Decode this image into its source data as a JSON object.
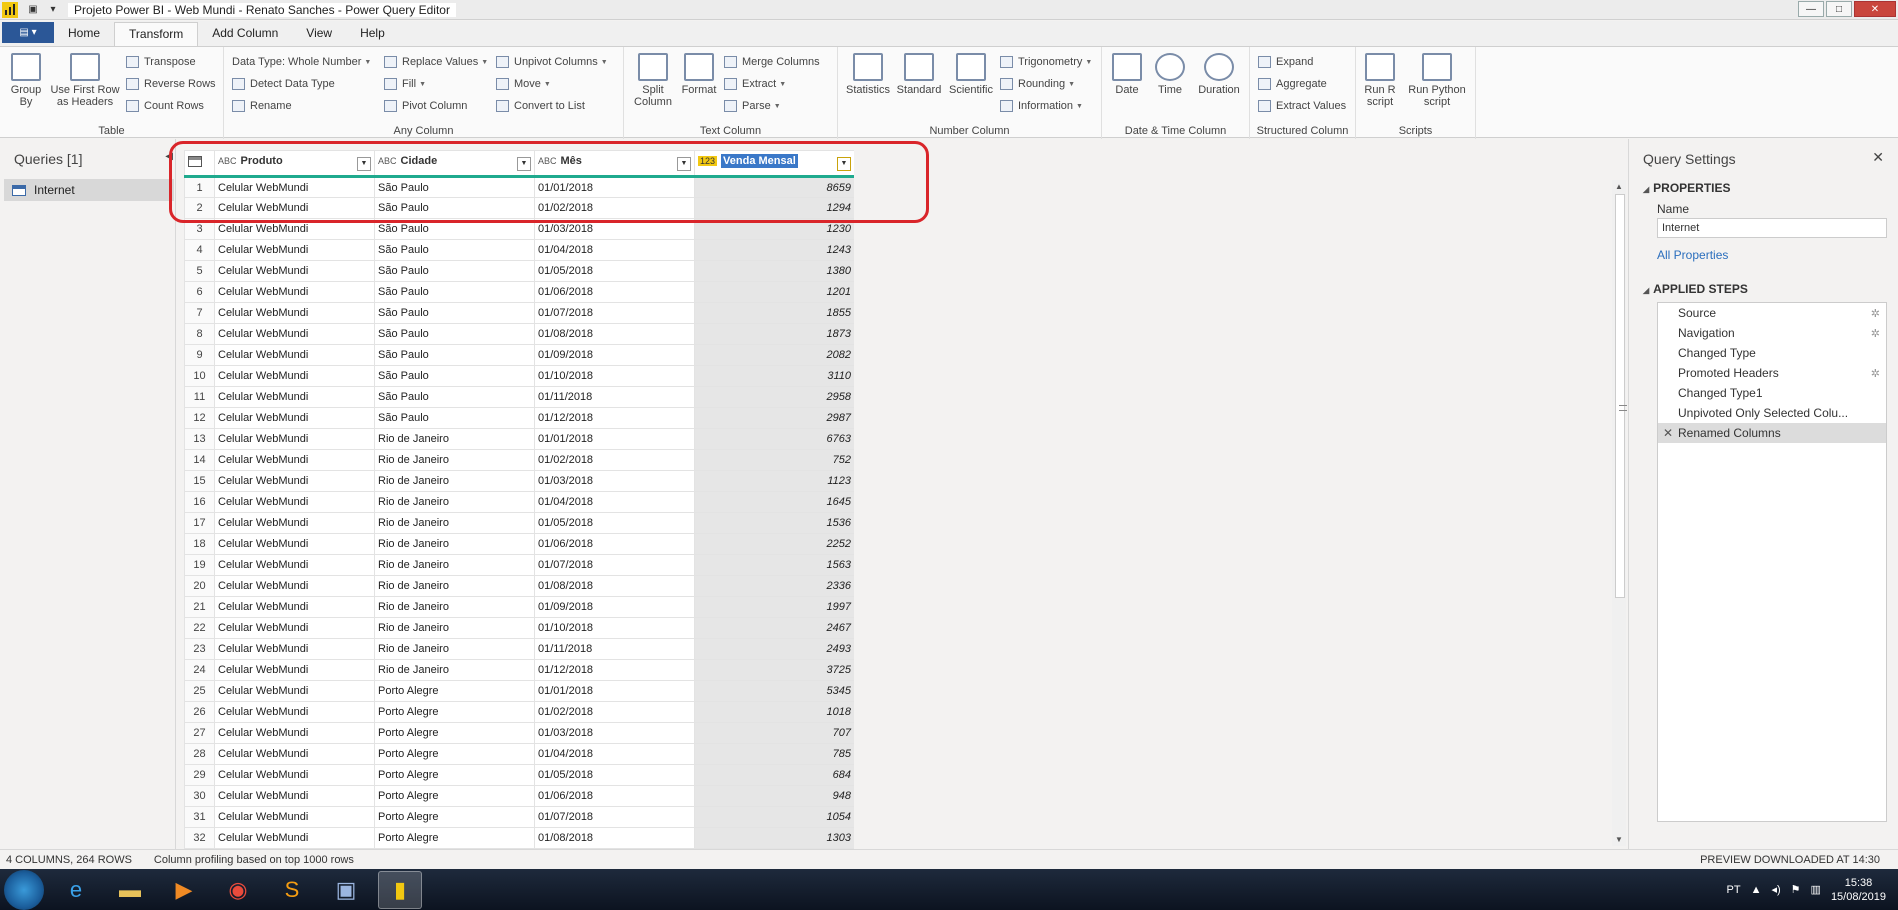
{
  "window": {
    "title": "Projeto Power BI - Web Mundi - Renato Sanches - Power Query Editor",
    "minimize": "—",
    "maximize": "□",
    "close": "✕"
  },
  "tabs": {
    "file": "▤ ▾",
    "items": [
      "Home",
      "Transform",
      "Add Column",
      "View",
      "Help"
    ],
    "active": "Transform"
  },
  "ribbon": {
    "table": {
      "label": "Table",
      "group_by": "Group By",
      "use_first_row": "Use First Row as Headers",
      "transpose": "Transpose",
      "reverse_rows": "Reverse Rows",
      "count_rows": "Count Rows"
    },
    "any_column": {
      "label": "Any Column",
      "data_type": "Data Type: Whole Number",
      "detect_data_type": "Detect Data Type",
      "rename": "Rename",
      "replace_values": "Replace Values",
      "fill": "Fill",
      "pivot_column": "Pivot Column",
      "unpivot_columns": "Unpivot Columns",
      "move": "Move",
      "convert_to_list": "Convert to List"
    },
    "text_column": {
      "label": "Text Column",
      "split_column": "Split Column",
      "format": "Format",
      "merge_columns": "Merge Columns",
      "extract": "Extract",
      "parse": "Parse"
    },
    "number_column": {
      "label": "Number Column",
      "statistics": "Statistics",
      "standard": "Standard",
      "scientific": "Scientific",
      "trigonometry": "Trigonometry",
      "rounding": "Rounding",
      "information": "Information"
    },
    "datetime_column": {
      "label": "Date & Time Column",
      "date": "Date",
      "time": "Time",
      "duration": "Duration"
    },
    "structured_column": {
      "label": "Structured Column",
      "expand": "Expand",
      "aggregate": "Aggregate",
      "extract_values": "Extract Values"
    },
    "scripts": {
      "label": "Scripts",
      "run_r": "Run R script",
      "run_python": "Run Python script"
    }
  },
  "queries": {
    "title": "Queries [1]",
    "items": [
      "Internet"
    ]
  },
  "grid": {
    "columns": [
      {
        "type": "ABC",
        "name": "Produto"
      },
      {
        "type": "ABC",
        "name": "Cidade"
      },
      {
        "type": "ABC",
        "name": "Mês"
      },
      {
        "type": "123",
        "name": "Venda Mensal"
      }
    ],
    "rows": [
      [
        "1",
        "Celular WebMundi",
        "São Paulo",
        "01/01/2018",
        "8659"
      ],
      [
        "2",
        "Celular WebMundi",
        "São Paulo",
        "01/02/2018",
        "1294"
      ],
      [
        "3",
        "Celular WebMundi",
        "São Paulo",
        "01/03/2018",
        "1230"
      ],
      [
        "4",
        "Celular WebMundi",
        "São Paulo",
        "01/04/2018",
        "1243"
      ],
      [
        "5",
        "Celular WebMundi",
        "São Paulo",
        "01/05/2018",
        "1380"
      ],
      [
        "6",
        "Celular WebMundi",
        "São Paulo",
        "01/06/2018",
        "1201"
      ],
      [
        "7",
        "Celular WebMundi",
        "São Paulo",
        "01/07/2018",
        "1855"
      ],
      [
        "8",
        "Celular WebMundi",
        "São Paulo",
        "01/08/2018",
        "1873"
      ],
      [
        "9",
        "Celular WebMundi",
        "São Paulo",
        "01/09/2018",
        "2082"
      ],
      [
        "10",
        "Celular WebMundi",
        "São Paulo",
        "01/10/2018",
        "3110"
      ],
      [
        "11",
        "Celular WebMundi",
        "São Paulo",
        "01/11/2018",
        "2958"
      ],
      [
        "12",
        "Celular WebMundi",
        "São Paulo",
        "01/12/2018",
        "2987"
      ],
      [
        "13",
        "Celular WebMundi",
        "Rio de Janeiro",
        "01/01/2018",
        "6763"
      ],
      [
        "14",
        "Celular WebMundi",
        "Rio de Janeiro",
        "01/02/2018",
        "752"
      ],
      [
        "15",
        "Celular WebMundi",
        "Rio de Janeiro",
        "01/03/2018",
        "1123"
      ],
      [
        "16",
        "Celular WebMundi",
        "Rio de Janeiro",
        "01/04/2018",
        "1645"
      ],
      [
        "17",
        "Celular WebMundi",
        "Rio de Janeiro",
        "01/05/2018",
        "1536"
      ],
      [
        "18",
        "Celular WebMundi",
        "Rio de Janeiro",
        "01/06/2018",
        "2252"
      ],
      [
        "19",
        "Celular WebMundi",
        "Rio de Janeiro",
        "01/07/2018",
        "1563"
      ],
      [
        "20",
        "Celular WebMundi",
        "Rio de Janeiro",
        "01/08/2018",
        "2336"
      ],
      [
        "21",
        "Celular WebMundi",
        "Rio de Janeiro",
        "01/09/2018",
        "1997"
      ],
      [
        "22",
        "Celular WebMundi",
        "Rio de Janeiro",
        "01/10/2018",
        "2467"
      ],
      [
        "23",
        "Celular WebMundi",
        "Rio de Janeiro",
        "01/11/2018",
        "2493"
      ],
      [
        "24",
        "Celular WebMundi",
        "Rio de Janeiro",
        "01/12/2018",
        "3725"
      ],
      [
        "25",
        "Celular WebMundi",
        "Porto Alegre",
        "01/01/2018",
        "5345"
      ],
      [
        "26",
        "Celular WebMundi",
        "Porto Alegre",
        "01/02/2018",
        "1018"
      ],
      [
        "27",
        "Celular WebMundi",
        "Porto Alegre",
        "01/03/2018",
        "707"
      ],
      [
        "28",
        "Celular WebMundi",
        "Porto Alegre",
        "01/04/2018",
        "785"
      ],
      [
        "29",
        "Celular WebMundi",
        "Porto Alegre",
        "01/05/2018",
        "684"
      ],
      [
        "30",
        "Celular WebMundi",
        "Porto Alegre",
        "01/06/2018",
        "948"
      ],
      [
        "31",
        "Celular WebMundi",
        "Porto Alegre",
        "01/07/2018",
        "1054"
      ],
      [
        "32",
        "Celular WebMundi",
        "Porto Alegre",
        "01/08/2018",
        "1303"
      ]
    ]
  },
  "settings": {
    "title": "Query Settings",
    "properties_title": "PROPERTIES",
    "name_label": "Name",
    "name_value": "Internet",
    "all_properties": "All Properties",
    "steps_title": "APPLIED STEPS",
    "steps": [
      {
        "label": "Source",
        "gear": true
      },
      {
        "label": "Navigation",
        "gear": true
      },
      {
        "label": "Changed Type",
        "gear": false
      },
      {
        "label": "Promoted Headers",
        "gear": true
      },
      {
        "label": "Changed Type1",
        "gear": false
      },
      {
        "label": "Unpivoted Only Selected Colu...",
        "gear": false
      },
      {
        "label": "Renamed Columns",
        "gear": false,
        "active": true
      }
    ]
  },
  "status": {
    "left": "4 COLUMNS, 264 ROWS",
    "mid": "Column profiling based on top 1000 rows",
    "right": "PREVIEW DOWNLOADED AT 14:30"
  },
  "taskbar": {
    "lang": "PT",
    "time": "15:38",
    "date": "15/08/2019"
  },
  "colors": {
    "accent": "#f2c811",
    "header_rule": "#1faa8e",
    "highlight": "#d9252a",
    "link": "#2a6ebd"
  }
}
